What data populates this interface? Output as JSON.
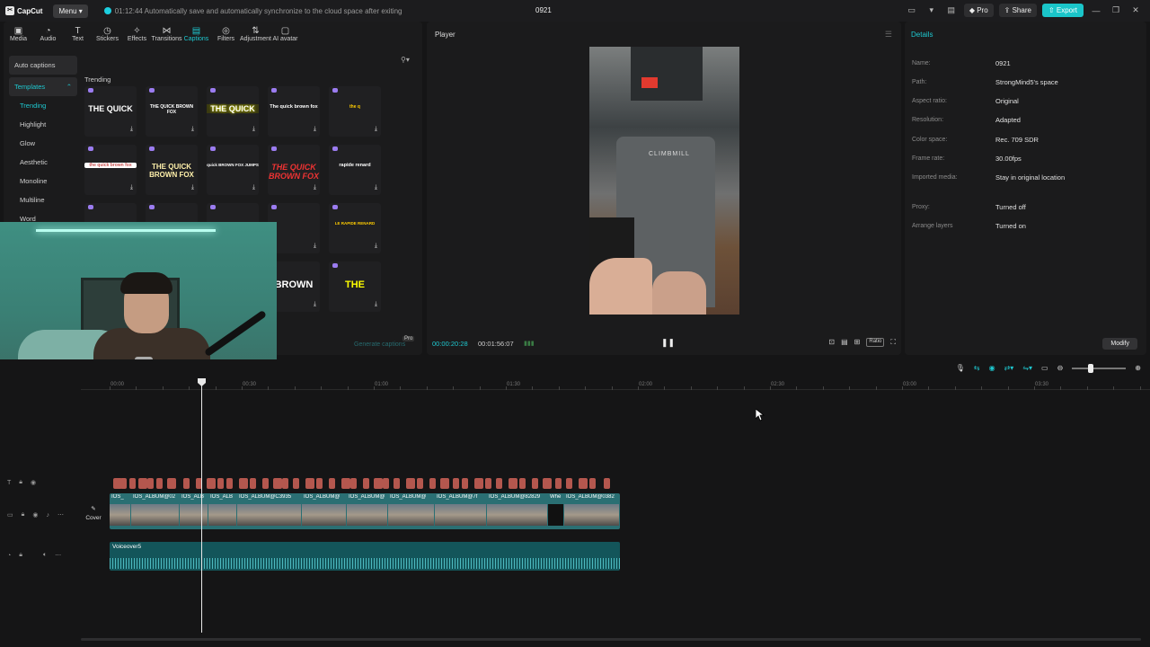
{
  "app": {
    "name": "CapCut",
    "menu_label": "Menu",
    "save_message": "01:12:44 Automatically save and automatically synchronize to the cloud space after exiting",
    "project_title": "0921",
    "pro_label": "Pro",
    "share_label": "Share",
    "export_label": "Export"
  },
  "toolbar": [
    {
      "label": "Media",
      "icon": "media-icon",
      "glyph": "▣"
    },
    {
      "label": "Audio",
      "icon": "audio-icon",
      "glyph": "◔"
    },
    {
      "label": "Text",
      "icon": "text-icon",
      "glyph": "T"
    },
    {
      "label": "Stickers",
      "icon": "sticker-icon",
      "glyph": "◷"
    },
    {
      "label": "Effects",
      "icon": "effects-icon",
      "glyph": "✧"
    },
    {
      "label": "Transitions",
      "icon": "transitions-icon",
      "glyph": "⋈"
    },
    {
      "label": "Captions",
      "icon": "captions-icon",
      "glyph": "▤"
    },
    {
      "label": "Filters",
      "icon": "filters-icon",
      "glyph": "◎"
    },
    {
      "label": "Adjustment",
      "icon": "adjustment-icon",
      "glyph": "⇅"
    },
    {
      "label": "AI avatar",
      "icon": "avatar-icon",
      "glyph": "▢"
    }
  ],
  "sidebar": {
    "auto_captions": "Auto captions",
    "templates": "Templates",
    "items": [
      "Trending",
      "Highlight",
      "Glow",
      "Aesthetic",
      "Monoline",
      "Multiline",
      "Word"
    ]
  },
  "templates": {
    "section_label": "Trending",
    "cards": [
      "THE QUICK",
      "THE QUICK BROWN FOX",
      "THE QUICK",
      "The quick brown fox",
      "the q",
      "the quick brown fox",
      "THE QUICK BROWN FOX",
      "quick BROWN FOX JUMPS",
      "THE QUICK BROWN FOX",
      "rapide renard",
      "",
      "",
      "",
      "",
      "LE RAPIDE RENARD",
      "",
      "",
      "",
      "BROWN",
      "THE"
    ],
    "generate_label": "Generate captions",
    "generate_pro": "Pro"
  },
  "webcam": {
    "label": "logi"
  },
  "player": {
    "title": "Player",
    "current_time": "00:00:20:28",
    "total_time": "00:01:56:07",
    "video_brand": "CLIMBMILL",
    "ratio_label": "Ratio"
  },
  "details": {
    "title": "Details",
    "rows": [
      {
        "label": "Name:",
        "value": "0921"
      },
      {
        "label": "Path:",
        "value": "StrongMind5's space"
      },
      {
        "label": "Aspect ratio:",
        "value": "Original"
      },
      {
        "label": "Resolution:",
        "value": "Adapted"
      },
      {
        "label": "Color space:",
        "value": "Rec. 709 SDR"
      },
      {
        "label": "Frame rate:",
        "value": "30.00fps"
      },
      {
        "label": "Imported media:",
        "value": "Stay in original location"
      },
      {
        "label": "Proxy:",
        "value": "Turned off"
      },
      {
        "label": "Arrange layers",
        "value": "Turned on"
      }
    ],
    "modify_label": "Modify"
  },
  "timeline": {
    "ruler": [
      "00:00",
      "00:30",
      "01:00",
      "01:30",
      "02:00",
      "02:30",
      "03:00",
      "03:30"
    ],
    "cover_label": "Cover",
    "video_clips": [
      "IOS_",
      "IOS_ALBUM@02",
      "IOS_ALB",
      "IOS_ALB",
      "IOS_ALBUM@C3935",
      "IOS_ALBUM@",
      "IOS_ALBUM@",
      "IOS_ALBUM@",
      "IOS_ALBUM@7f",
      "IOS_ALBUM@82829",
      "Whe",
      "IOS_ALBUM@0382"
    ],
    "audio_label": "Voiceover5"
  }
}
